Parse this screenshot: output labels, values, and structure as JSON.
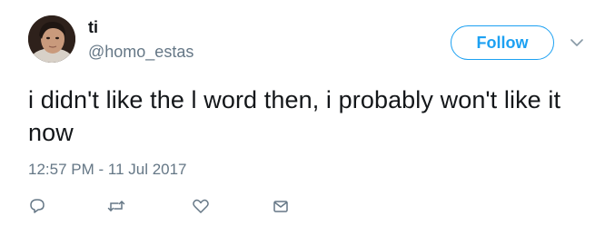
{
  "user": {
    "display_name": "ti",
    "handle": "@homo_estas"
  },
  "header": {
    "follow_label": "Follow"
  },
  "tweet": {
    "text": "i didn't like the l word then, i probably won't like it now",
    "timestamp": "12:57 PM - 11 Jul 2017"
  },
  "icons": {
    "reply": "reply-icon",
    "retweet": "retweet-icon",
    "like": "like-icon",
    "dm": "direct-message-icon",
    "caret": "chevron-down-icon"
  },
  "colors": {
    "accent": "#1da1f2",
    "text": "#14171a",
    "secondary": "#657786"
  }
}
